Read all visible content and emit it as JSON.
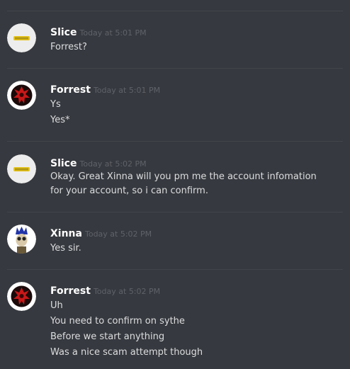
{
  "messages": [
    {
      "author": "Slice",
      "timestamp": "Today at 5:01 PM",
      "avatar_icon": "slice-logo-avatar",
      "lines": [
        "Forrest?"
      ]
    },
    {
      "author": "Forrest",
      "timestamp": "Today at 5:01 PM",
      "avatar_icon": "red-scorpion-emblem-avatar",
      "lines": [
        "Ys",
        "Yes*"
      ]
    },
    {
      "author": "Slice",
      "timestamp": "Today at 5:02 PM",
      "avatar_icon": "slice-logo-avatar",
      "lines": [
        "Okay. Great Xinna will you pm me the account infomation",
        "for your account, so i can confirm."
      ]
    },
    {
      "author": "Xinna",
      "timestamp": "Today at 5:02 PM",
      "avatar_icon": "crowned-character-avatar",
      "lines": [
        "Yes sir."
      ]
    },
    {
      "author": "Forrest",
      "timestamp": "Today at 5:02 PM",
      "avatar_icon": "red-scorpion-emblem-avatar",
      "lines": [
        "Uh",
        "You need to confirm on sythe",
        "Before we start anything",
        "Was a nice scam attempt though"
      ]
    }
  ],
  "colors": {
    "background": "#36393f",
    "username": "#ffffff",
    "message_text": "#dcddde",
    "timestamp": "#5f6268",
    "divider": "#42454a"
  }
}
